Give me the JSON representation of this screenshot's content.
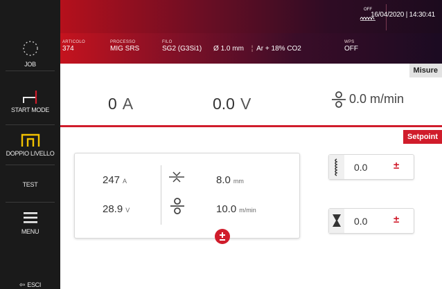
{
  "rail": {
    "job": "JOB",
    "start_mode": "START MODE",
    "doppio_livello": "DOPPIO LIVELLO",
    "test": "TEST",
    "menu": "MENU",
    "esci": "ESCI"
  },
  "header": {
    "articolo_caption": "ARTICOLO",
    "articolo_value": "374",
    "processo_caption": "PROCESSO",
    "processo_value": "MIG SRS",
    "filo_caption": "FILO",
    "filo_material": "SG2 (G3Si1)",
    "filo_diameter": "Ø 1.0 mm",
    "filo_gas": "Ar + 18% CO2",
    "wps_caption": "WPS",
    "wps_value": "OFF",
    "off_caption": "OFF",
    "datetime": "16/04/2020 | 14:30:41"
  },
  "measures": {
    "tag": "Misure",
    "current_value": "0",
    "current_unit": "A",
    "voltage_value": "0.0",
    "voltage_unit": "V",
    "wire_speed": "0.0 m/min"
  },
  "setpoint": {
    "tag": "Setpoint",
    "current_value": "247",
    "current_unit": "A",
    "voltage_value": "28.9",
    "voltage_unit": "V",
    "arc_length_value": "8.0",
    "arc_length_unit": "mm",
    "wire_speed_value": "10.0",
    "wire_speed_unit": "m/min",
    "inductance_value": "0.0",
    "crater_value": "0.0"
  },
  "colors": {
    "accent_red": "#d01c2b",
    "rail_bg": "#1a1a1a",
    "active_yellow": "#f2c200"
  },
  "icons": {
    "job": "dotted-circle-icon",
    "start_mode": "start-mode-icon",
    "doppio_livello": "square-wave-icon",
    "menu": "hamburger-icon",
    "esci": "exit-icon",
    "wire_speed": "wire-feed-icon",
    "arc_length": "arc-length-icon",
    "inductance": "inductance-icon",
    "crater": "crater-icon",
    "adjust": "plus-minus-icon"
  }
}
